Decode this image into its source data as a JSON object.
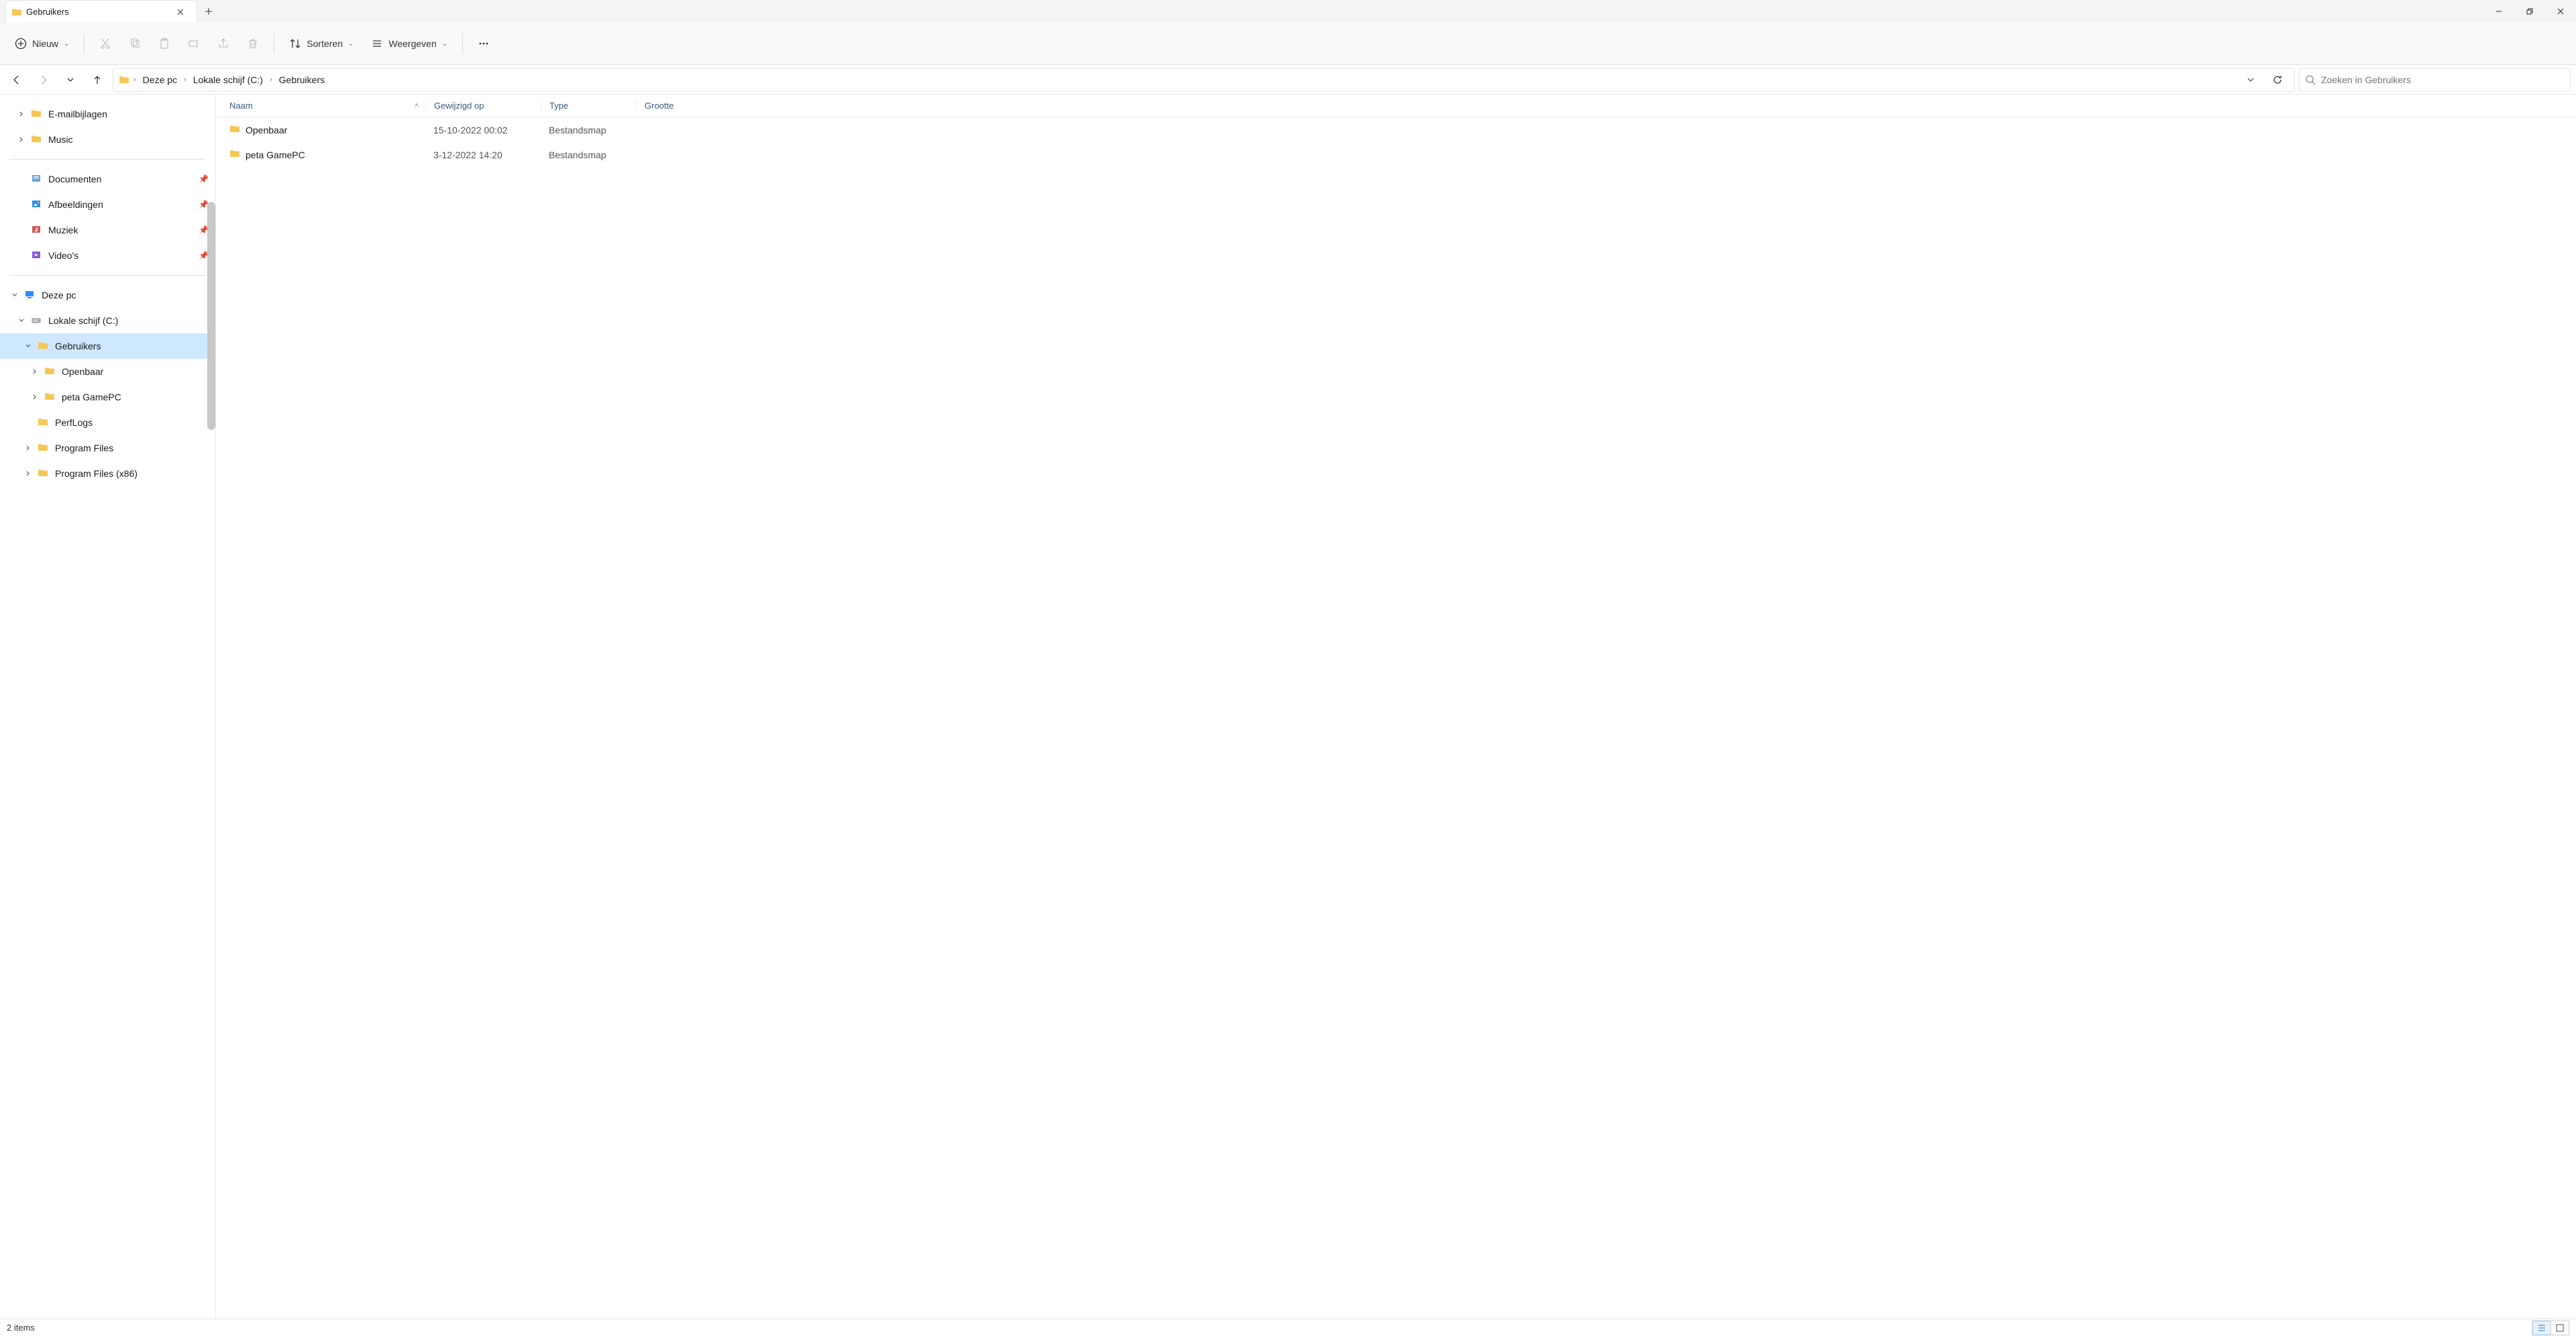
{
  "tab": {
    "title": "Gebruikers"
  },
  "toolbar": {
    "new_label": "Nieuw",
    "sort_label": "Sorteren",
    "view_label": "Weergeven"
  },
  "breadcrumb": {
    "segments": [
      "Deze pc",
      "Lokale schijf (C:)",
      "Gebruikers"
    ]
  },
  "search": {
    "placeholder": "Zoeken in Gebruikers"
  },
  "sidebar": {
    "quick": [
      {
        "label": "E-mailbijlagen",
        "expander": "right",
        "icon": "folder",
        "pinned": false,
        "indent": 1
      },
      {
        "label": "Music",
        "expander": "right",
        "icon": "folder",
        "pinned": false,
        "indent": 1
      }
    ],
    "pinned": [
      {
        "label": "Documenten",
        "icon": "docfolder",
        "pinned": true
      },
      {
        "label": "Afbeeldingen",
        "icon": "picfolder",
        "pinned": true
      },
      {
        "label": "Muziek",
        "icon": "musicfolder",
        "pinned": true
      },
      {
        "label": "Video's",
        "icon": "videofolder",
        "pinned": true
      }
    ],
    "tree": [
      {
        "label": "Deze pc",
        "icon": "pc",
        "expander": "down",
        "indent": 0
      },
      {
        "label": "Lokale schijf (C:)",
        "icon": "drive",
        "expander": "down",
        "indent": 1
      },
      {
        "label": "Gebruikers",
        "icon": "folder",
        "expander": "down",
        "indent": 2,
        "selected": true
      },
      {
        "label": "Openbaar",
        "icon": "folder",
        "expander": "right",
        "indent": 3
      },
      {
        "label": "peta GamePC",
        "icon": "folder",
        "expander": "right",
        "indent": 3
      },
      {
        "label": "PerfLogs",
        "icon": "folder",
        "expander": "none",
        "indent": 2
      },
      {
        "label": "Program Files",
        "icon": "folder",
        "expander": "right",
        "indent": 2
      },
      {
        "label": "Program Files (x86)",
        "icon": "folder",
        "expander": "right",
        "indent": 2
      }
    ]
  },
  "columns": {
    "name": "Naam",
    "modified": "Gewijzigd op",
    "type": "Type",
    "size": "Grootte"
  },
  "rows": [
    {
      "name": "Openbaar",
      "modified": "15-10-2022 00:02",
      "type": "Bestandsmap",
      "size": ""
    },
    {
      "name": "peta GamePC",
      "modified": "3-12-2022 14:20",
      "type": "Bestandsmap",
      "size": ""
    }
  ],
  "status": {
    "count": "2 items"
  }
}
